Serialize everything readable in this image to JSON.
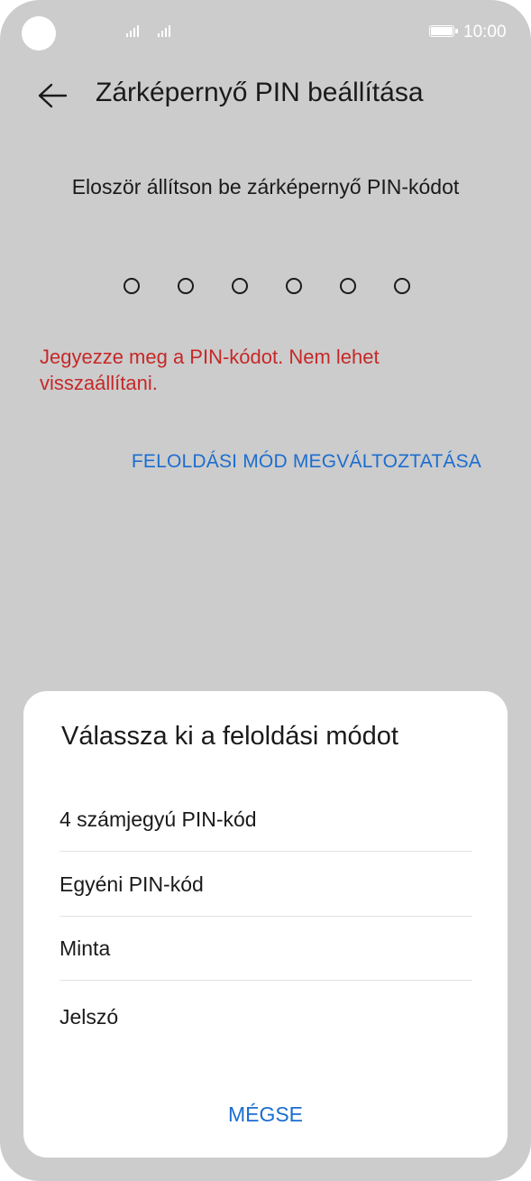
{
  "status_bar": {
    "time": "10:00",
    "icons": [
      "camera-hole",
      "signal-icon",
      "signal-icon",
      "battery-icon"
    ]
  },
  "header": {
    "back_icon": "arrow-left-icon",
    "title": "Zárképernyő PIN beállítása"
  },
  "main": {
    "instruction": "Eloször állítson be zárképernyő PIN-kódot",
    "pin_length": 6,
    "warning": "Jegyezze meg a PIN-kódot. Nem lehet visszaállítani.",
    "change_mode_link": "FELOLDÁSI MÓD MEGVÁLTOZTATÁSA"
  },
  "dialog": {
    "title": "Válassza ki a feloldási módot",
    "options": [
      {
        "label": "4 számjegyú PIN-kód"
      },
      {
        "label": "Egyéni PIN-kód"
      },
      {
        "label": "Minta"
      },
      {
        "label": "Jelszó"
      }
    ],
    "cancel_label": "MÉGSE"
  },
  "colors": {
    "background": "#cccccc",
    "accent": "#1c6dd0",
    "warning": "#c62828",
    "text": "#1a1a1a",
    "sheet": "#ffffff"
  }
}
